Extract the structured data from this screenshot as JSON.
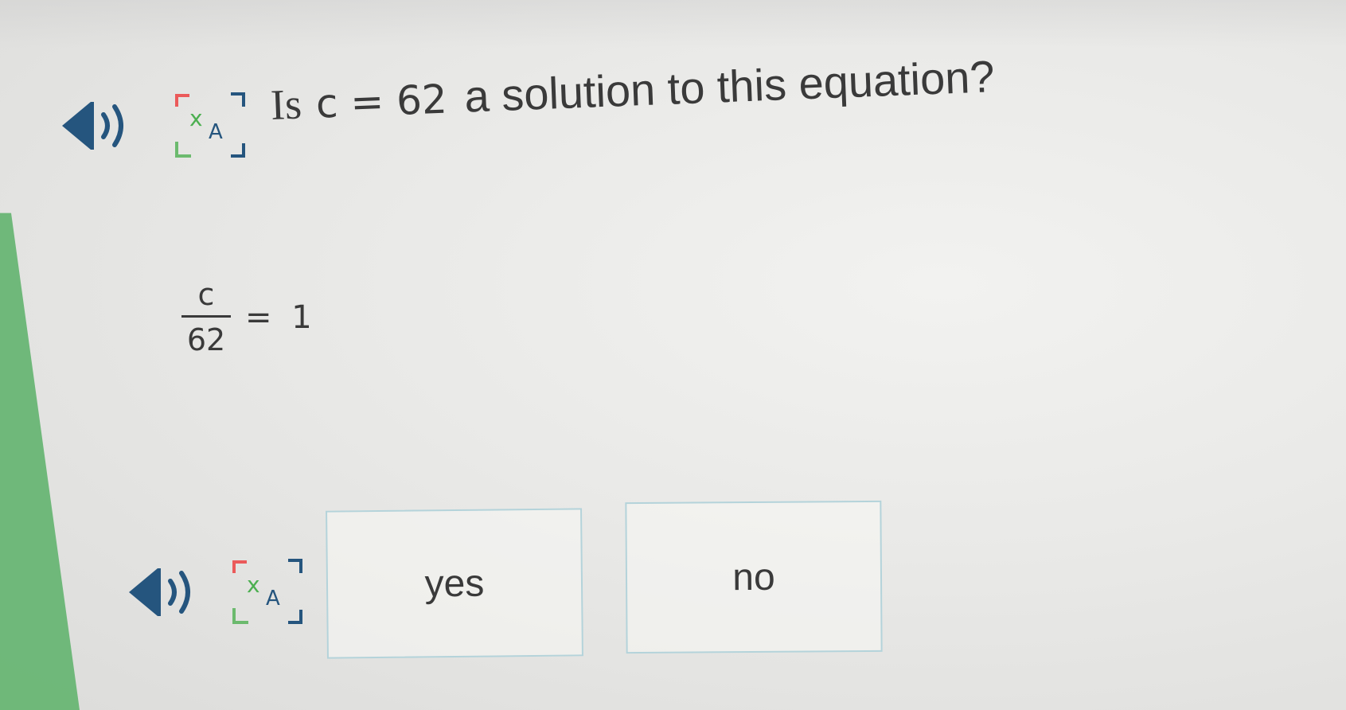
{
  "question": {
    "prefix": "Is",
    "math": "c = 62",
    "suffix": "a solution to this equation?"
  },
  "equation": {
    "numerator": "c",
    "denominator": "62",
    "right_side": "= 1"
  },
  "answers": {
    "yes_label": "yes",
    "no_label": "no"
  },
  "icons": {
    "audio": "speaker-icon",
    "translate": "translate-icon"
  },
  "colors": {
    "accent_green": "#68b574",
    "answer_border": "#b4d3da",
    "text": "#3a3a3a"
  }
}
